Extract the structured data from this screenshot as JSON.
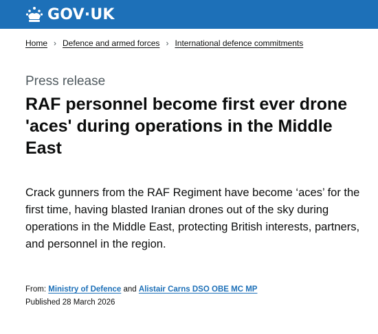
{
  "header": {
    "logo_text": "GOV",
    "logo_dot": "·",
    "logo_suffix": "UK",
    "logo_icon": "crown-icon",
    "brand_color": "#1d70b8"
  },
  "breadcrumbs": [
    {
      "label": "Home"
    },
    {
      "label": "Defence and armed forces"
    },
    {
      "label": "International defence commitments"
    }
  ],
  "article": {
    "caption": "Press release",
    "title": "RAF personnel become first ever drone 'aces' during operations in the Middle East",
    "lede": "Crack gunners from the RAF Regiment have become ‘aces’ for the first time, having blasted Iranian drones out of the sky during operations in the Middle East, protecting British interests, partners, and personnel in the region."
  },
  "meta": {
    "from_label": "From:",
    "from_org": "Ministry of Defence",
    "and_label": "and",
    "from_person": "Alistair Carns DSO OBE MC MP",
    "published_label": "Published",
    "published_date": "28 March 2026"
  }
}
